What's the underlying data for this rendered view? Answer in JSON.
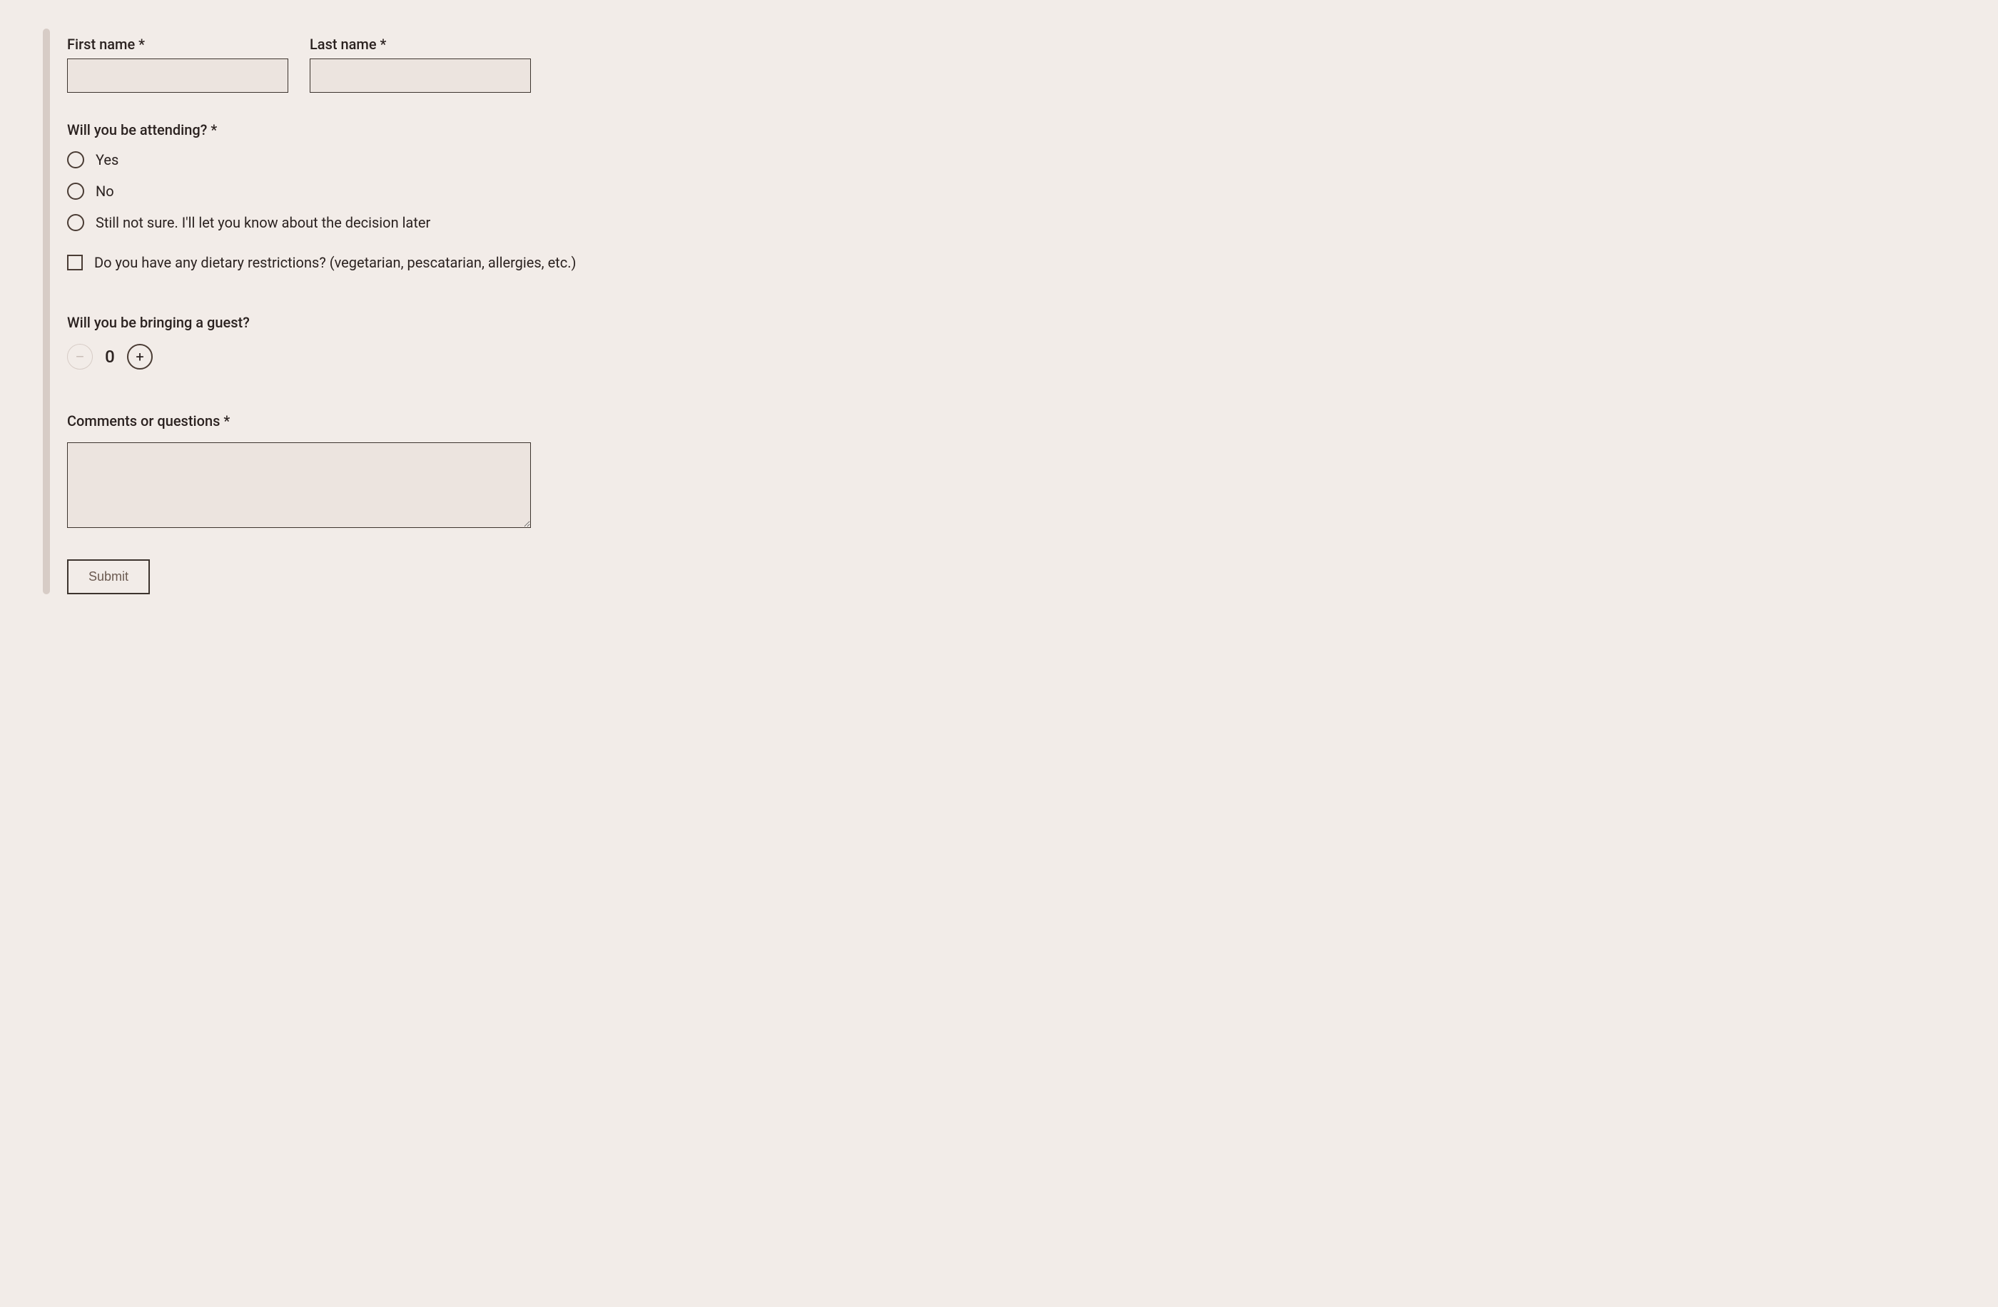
{
  "form": {
    "first_name": {
      "label": "First name *",
      "value": ""
    },
    "last_name": {
      "label": "Last name *",
      "value": ""
    },
    "attending": {
      "label": "Will you be attending? *",
      "options": [
        "Yes",
        "No",
        "Still not sure. I'll let you know about the decision later"
      ],
      "selected": null
    },
    "dietary": {
      "label": "Do you have any dietary restrictions? (vegetarian, pescatarian, allergies, etc.)",
      "checked": false
    },
    "guest": {
      "label": "Will you be bringing a guest?",
      "value": "0",
      "minus_glyph": "–",
      "plus_glyph": "+"
    },
    "comments": {
      "label": "Comments or questions *",
      "value": ""
    },
    "submit_label": "Submit"
  }
}
